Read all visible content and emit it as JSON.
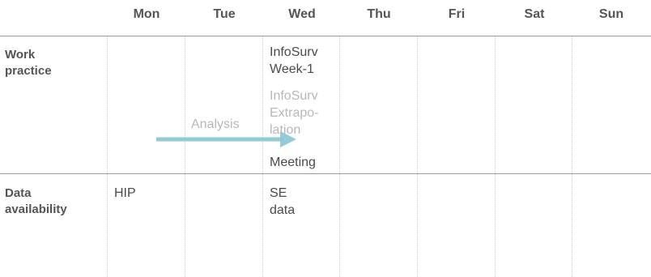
{
  "days": [
    "Mon",
    "Tue",
    "Wed",
    "Thu",
    "Fri",
    "Sat",
    "Sun"
  ],
  "rows": {
    "work_practice": {
      "label_line1": "Work",
      "label_line2": "practice",
      "wed_item1_line1": "InfoSurv",
      "wed_item1_line2": "Week-1",
      "wed_item2_line1": "InfoSurv",
      "wed_item2_line2": "Extrapo-",
      "wed_item2_line3": "lation",
      "wed_item3": "Meeting",
      "tue_item": "Analysis"
    },
    "data_availability": {
      "label_line1": "Data",
      "label_line2": "availability",
      "mon_item": "HIP",
      "wed_item_line1": "SE",
      "wed_item_line2": "data"
    }
  },
  "colors": {
    "arrow": "#8ec8d6",
    "rule": "#9a9a9a",
    "text": "#555555",
    "faded_text": "#b8b8b8"
  }
}
